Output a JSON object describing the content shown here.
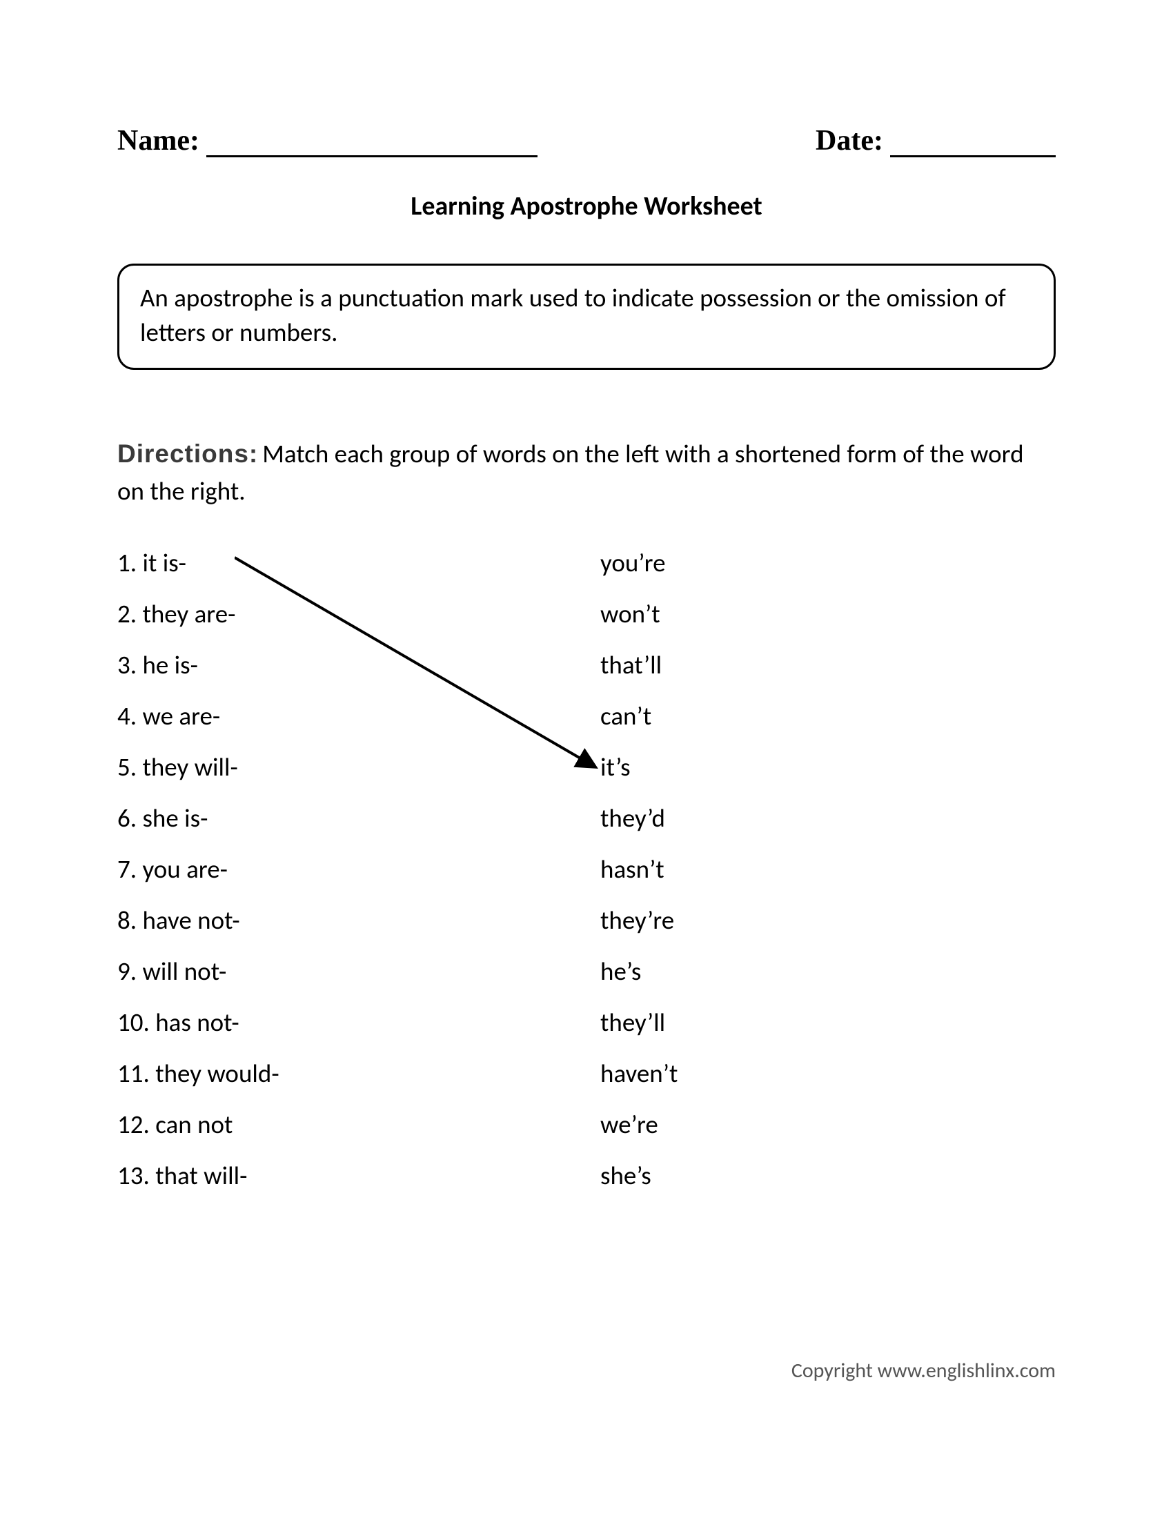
{
  "header": {
    "name_label": "Name:",
    "date_label": "Date:"
  },
  "title": "Learning Apostrophe Worksheet",
  "definition": "An apostrophe is a punctuation mark used to indicate possession or the omission of letters or numbers.",
  "directions": {
    "label": "Directions:",
    "text": "Match each group of words on the left with a shortened form of the word on the right."
  },
  "left_items": [
    "1. it is-",
    "2. they are-",
    "3. he is-",
    "4. we are-",
    "5. they will-",
    "6. she is-",
    "7. you are-",
    "8. have not-",
    "9. will not-",
    "10. has not-",
    "11. they would-",
    "12. can not",
    "13. that will-"
  ],
  "right_items": [
    "you’re",
    "won’t",
    "that’ll",
    "can’t",
    "it’s",
    "they’d",
    "hasn’t",
    "they’re",
    "he’s",
    "they’ll",
    "haven’t",
    "we’re",
    "she’s"
  ],
  "example_arrow": {
    "from_left_index": 0,
    "to_right_index": 4
  },
  "copyright": "Copyright www.englishlinx.com"
}
